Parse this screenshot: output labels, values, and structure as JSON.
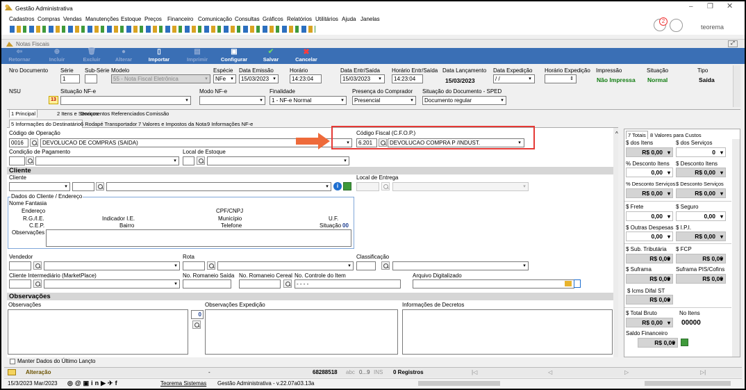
{
  "window": {
    "title": "Gestão Administrativa"
  },
  "menu": [
    "Cadastros",
    "Compras",
    "Vendas",
    "Manutenções",
    "Estoque",
    "Preços",
    "Financeiro",
    "Comunicação",
    "Consultas",
    "Gráficos",
    "Relatórios",
    "Utilitários",
    "Ajuda",
    "Janelas"
  ],
  "header_right": {
    "badge": "2",
    "user": "teorema"
  },
  "child_title": "Notas Fiscais",
  "toolbar": [
    "Retornar",
    "Incluir",
    "Excluir",
    "Alterar",
    "Importar",
    "Imprimir",
    "Configurar",
    "Salvar",
    "Cancelar"
  ],
  "row1": {
    "nro_documento_label": "Nro Documento",
    "serie_label": "Série",
    "serie_value": "1",
    "subserie_label": "Sub-Série",
    "modelo_label": "Modelo",
    "modelo_value": "55 - Nota Fiscal Eletrônica",
    "especie_label": "Espécie",
    "especie_value": "NFe",
    "data_emissao_label": "Data Emissão",
    "data_emissao_value": "15/03/2023",
    "horario_label": "Horário",
    "horario_value": "14:23:04",
    "data_entr_label": "Data Entr/Saída",
    "data_entr_value": "15/03/2023",
    "horario_entr_label": "Horário Entr/Saída",
    "horario_entr_value": "14:23:04",
    "data_lanc_label": "Data Lançamento",
    "data_lanc_value": "15/03/2023",
    "data_exp_label": "Data Expedição",
    "data_exp_value": "/ /",
    "horario_exp_label": "Horário Expedição",
    "impressao_label": "Impressão",
    "impressao_value": "Não Impressa",
    "situacao_label": "Situação",
    "situacao_value": "Normal",
    "tipo_label": "Tipo",
    "tipo_value": "Saída"
  },
  "row2": {
    "nsu_label": "NSU",
    "situacao_nfe_label": "Situação NF-e",
    "situacao_nfe_code": "13",
    "modo_nfe_label": "Modo NF-e",
    "finalidade_label": "Finalidade",
    "finalidade_value": "1 - NF-e Normal",
    "presenca_label": "Presença do Comprador",
    "presenca_value": "Presencial",
    "situacao_doc_label": "Situação do Documento - SPED",
    "situacao_doc_value": "Documento regular"
  },
  "tabs1": [
    "1 Principal",
    "2 Itens e Serviços",
    "Documentos Referenciados",
    "Comissão"
  ],
  "tabs2": [
    "5 Informações do Destinatário",
    "6 Rodapé Transportador",
    "7 Valores e Impostos da Nota",
    "9 Informações NF-e"
  ],
  "form": {
    "codigo_operacao_label": "Código de Operação",
    "codigo_operacao_code": "0016",
    "codigo_operacao_desc": "DEVOLUCAO DE COMPRAS (SAIDA)",
    "cfop_label": "Código Fiscal (C.F.O.P.)",
    "cfop_code": "6.201",
    "cfop_desc": "DEVOLUCAO COMPRA P /INDUST.",
    "cond_pagamento_label": "Condição de Pagamento",
    "local_estoque_label": "Local de Estoque",
    "cliente_section": "Cliente",
    "cliente_label": "Cliente",
    "local_entrega_label": "Local de Entrega",
    "dados_cliente_title": "Dados do Cliente / Endereço",
    "nome_fantasia": "Nome Fantasia",
    "endereco": "Endereço",
    "cpf_cnpj": "CPF/CNPJ",
    "rg_ie": "R.G./I.E.",
    "indicador_ie": "Indicador I.E.",
    "municipio": "Município",
    "uf": "U.F.",
    "cep": "C.E.P.",
    "bairro": "Bairro",
    "telefone": "Telefone",
    "situacao": "Situação",
    "situacao_code": "00",
    "observacoes": "Observações",
    "vendedor_label": "Vendedor",
    "rota_label": "Rota",
    "classificacao_label": "Classificação",
    "cliente_intermediario_label": "Cliente Intermediário (MarketPlace)",
    "no_romaneio_saida_label": "No. Romaneio Saída",
    "no_romaneio_cereal_label": "No. Romaneio Cereal",
    "no_controle_item_label": "No. Controle do Item",
    "no_controle_item_value": "- - - -",
    "arquivo_label": "Arquivo Digitalizado",
    "observacoes_section": "Observações",
    "obs_label": "Observações",
    "obs_exp_label": "Observações Expedição",
    "info_decretos_label": "Informações de Decretos",
    "obs_counter": "0",
    "manter_dados_label": "Manter Dados do Último Lançto"
  },
  "totals": {
    "tabs": [
      "7 Totais",
      "8 Valores para Custos"
    ],
    "items": [
      {
        "label": "$ dos Itens",
        "value": "R$ 0,00"
      },
      {
        "label": "$ dos Serviços",
        "value": "0"
      },
      {
        "label": "% Desconto Itens",
        "value": "0,00"
      },
      {
        "label": "$ Desconto Itens",
        "value": "R$ 0,00"
      },
      {
        "label": "% Desconto Serviços",
        "value": "R$ 0,00"
      },
      {
        "label": "$ Desconto Serviços",
        "value": "R$ 0,00"
      },
      {
        "label": "$ Frete",
        "value": "0,00"
      },
      {
        "label": "$ Seguro",
        "value": "0,00"
      },
      {
        "label": "$ Outras Despesas",
        "value": "0,00"
      },
      {
        "label": "$ I.P.I.",
        "value": "R$ 0,00"
      },
      {
        "label": "$ Sub. Tributária",
        "value": "R$ 0,00"
      },
      {
        "label": "$ FCP",
        "value": "R$ 0,00"
      },
      {
        "label": "$ Suframa",
        "value": "R$ 0,00"
      },
      {
        "label": "Suframa PIS/Cofins",
        "value": "R$ 0,00"
      },
      {
        "label": "$ Icms Difal ST",
        "value": "R$ 0,00"
      },
      {
        "label": "$ Total Bruto",
        "value": "R$ 0,00"
      },
      {
        "label": "No Itens",
        "value": "00000"
      },
      {
        "label": "Saldo Financeiro",
        "value": "R$ 0,00"
      }
    ]
  },
  "statusbar1": {
    "mode": "Alteração",
    "dash": "-",
    "num": "68288518",
    "abc": "abc",
    "range": "0...9",
    "ins": "INS",
    "registros": "0 Registros"
  },
  "statusbar2": {
    "date": "15/3/2023 Mar/2023",
    "company": "Teorema Sistemas",
    "app_version": "Gestão Administrativa - v.22.07a03.13a"
  },
  "colors": {
    "toolbar_blue": "#3a6fb5",
    "highlight_red": "#e53935",
    "arrow_orange": "#ee6a3a",
    "green_text": "#107c10",
    "status_yellow": "#f4d35e"
  }
}
